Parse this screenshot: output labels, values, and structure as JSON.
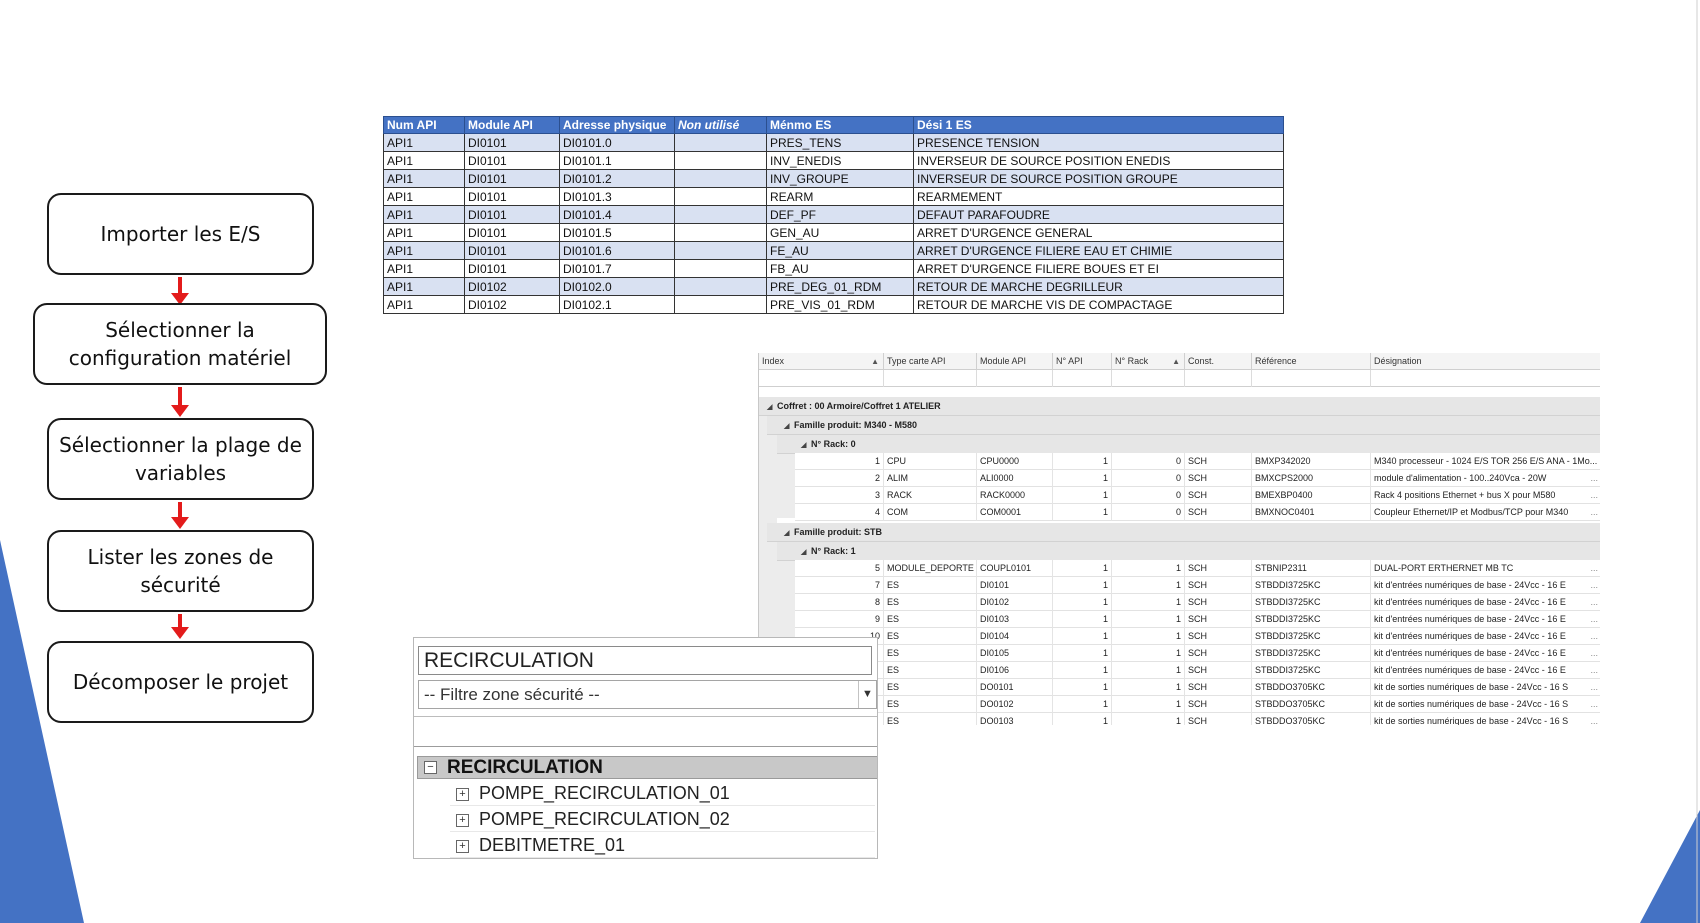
{
  "flowchart": {
    "steps": [
      "Importer les E/S",
      "Sélectionner la configuration matériel",
      "Sélectionner la plage de variables",
      "Lister les zones de sécurité",
      "Décomposer le projet"
    ],
    "arrow_color": "#e31b1b"
  },
  "io_table": {
    "headers": [
      "Num API",
      "Module API",
      "Adresse physique",
      "Non utilisé",
      "Ménmo ES",
      "Dési 1 ES"
    ],
    "rows": [
      [
        "API1",
        "DI0101",
        "DI0101.0",
        "",
        "PRES_TENS",
        "PRESENCE TENSION"
      ],
      [
        "API1",
        "DI0101",
        "DI0101.1",
        "",
        "INV_ENEDIS",
        "INVERSEUR DE SOURCE  POSITION ENEDIS"
      ],
      [
        "API1",
        "DI0101",
        "DI0101.2",
        "",
        "INV_GROUPE",
        "INVERSEUR DE SOURCE  POSITION GROUPE"
      ],
      [
        "API1",
        "DI0101",
        "DI0101.3",
        "",
        "REARM",
        "REARMEMENT"
      ],
      [
        "API1",
        "DI0101",
        "DI0101.4",
        "",
        "DEF_PF",
        "DEFAUT PARAFOUDRE"
      ],
      [
        "API1",
        "DI0101",
        "DI0101.5",
        "",
        "GEN_AU",
        "ARRET D'URGENCE  GENERAL"
      ],
      [
        "API1",
        "DI0101",
        "DI0101.6",
        "",
        "FE_AU",
        "ARRET D'URGENCE  FILIERE EAU ET CHIMIE"
      ],
      [
        "API1",
        "DI0101",
        "DI0101.7",
        "",
        "FB_AU",
        "ARRET D'URGENCE  FILIERE BOUES ET EI"
      ],
      [
        "API1",
        "DI0102",
        "DI0102.0",
        "",
        "PRE_DEG_01_RDM",
        "RETOUR DE MARCHE  DEGRILLEUR"
      ],
      [
        "API1",
        "DI0102",
        "DI0102.1",
        "",
        "PRE_VIS_01_RDM",
        "RETOUR DE MARCHE  VIS DE COMPACTAGE"
      ]
    ],
    "header_color": "#4472c4",
    "band_color": "#d9e1f2"
  },
  "hardware_grid": {
    "headers": [
      "Index",
      "Type carte API",
      "Module API",
      "N° API",
      "N° Rack",
      "Const.",
      "Référence",
      "Désignation"
    ],
    "coffret_label": "Coffret : 00 Armoire/Coffret 1 ATELIER",
    "family1_label": "Famille produit: M340 - M580",
    "rack0_label": "N° Rack: 0",
    "family2_label": "Famille produit: STB",
    "rack1_label": "N° Rack: 1",
    "rack0_rows": [
      [
        "1",
        "CPU",
        "CPU0000",
        "1",
        "0",
        "SCH",
        "BMXP342020",
        "M340 processeur - 1024 E/S TOR 256 E/S ANA - 1Mo...",
        ""
      ],
      [
        "2",
        "ALIM",
        "ALI0000",
        "1",
        "0",
        "SCH",
        "BMXCPS2000",
        "module d'alimentation - 100..240Vca - 20W",
        "..."
      ],
      [
        "3",
        "RACK",
        "RACK0000",
        "1",
        "0",
        "SCH",
        "BMEXBP0400",
        "Rack 4 positions Ethernet + bus X pour M580",
        "..."
      ],
      [
        "4",
        "COM",
        "COM0001",
        "1",
        "0",
        "SCH",
        "BMXNOC0401",
        "Coupleur Ethernet/IP et Modbus/TCP pour M340",
        "..."
      ]
    ],
    "rack1_rows": [
      [
        "5",
        "MODULE_DEPORTE",
        "COUPL0101",
        "1",
        "1",
        "SCH",
        "STBNIP2311",
        "DUAL-PORT ERTHERNET MB TC",
        "..."
      ],
      [
        "7",
        "ES",
        "DI0101",
        "1",
        "1",
        "SCH",
        "STBDDI3725KC",
        "kit d'entrées numériques de base - 24Vcc - 16 E",
        "..."
      ],
      [
        "8",
        "ES",
        "DI0102",
        "1",
        "1",
        "SCH",
        "STBDDI3725KC",
        "kit d'entrées numériques de base - 24Vcc - 16 E",
        "..."
      ],
      [
        "9",
        "ES",
        "DI0103",
        "1",
        "1",
        "SCH",
        "STBDDI3725KC",
        "kit d'entrées numériques de base - 24Vcc - 16 E",
        "..."
      ],
      [
        "10",
        "ES",
        "DI0104",
        "1",
        "1",
        "SCH",
        "STBDDI3725KC",
        "kit d'entrées numériques de base - 24Vcc - 16 E",
        "..."
      ],
      [
        "",
        "ES",
        "DI0105",
        "1",
        "1",
        "SCH",
        "STBDDI3725KC",
        "kit d'entrées numériques de base - 24Vcc - 16 E",
        "..."
      ],
      [
        "",
        "ES",
        "DI0106",
        "1",
        "1",
        "SCH",
        "STBDDI3725KC",
        "kit d'entrées numériques de base - 24Vcc - 16 E",
        "..."
      ],
      [
        "",
        "ES",
        "DO0101",
        "1",
        "1",
        "SCH",
        "STBDDO3705KC",
        "kit de sorties numériques de base - 24Vcc - 16 S",
        "..."
      ],
      [
        "",
        "ES",
        "DO0102",
        "1",
        "1",
        "SCH",
        "STBDDO3705KC",
        "kit de sorties numériques de base - 24Vcc - 16 S",
        "..."
      ],
      [
        "",
        "ES",
        "DO0103",
        "1",
        "1",
        "SCH",
        "STBDDO3705KC",
        "kit de sorties numériques de base - 24Vcc - 16 S",
        "..."
      ]
    ]
  },
  "zone_panel": {
    "title_value": "RECIRCULATION",
    "filter_placeholder": "-- Filtre zone sécurité --",
    "root_label": "RECIRCULATION",
    "root_toggle": "−",
    "child_toggle": "+",
    "children": [
      "POMPE_RECIRCULATION_01",
      "POMPE_RECIRCULATION_02",
      "DEBITMETRE_01"
    ]
  },
  "theme": {
    "triangle_color": "#4472c4"
  }
}
